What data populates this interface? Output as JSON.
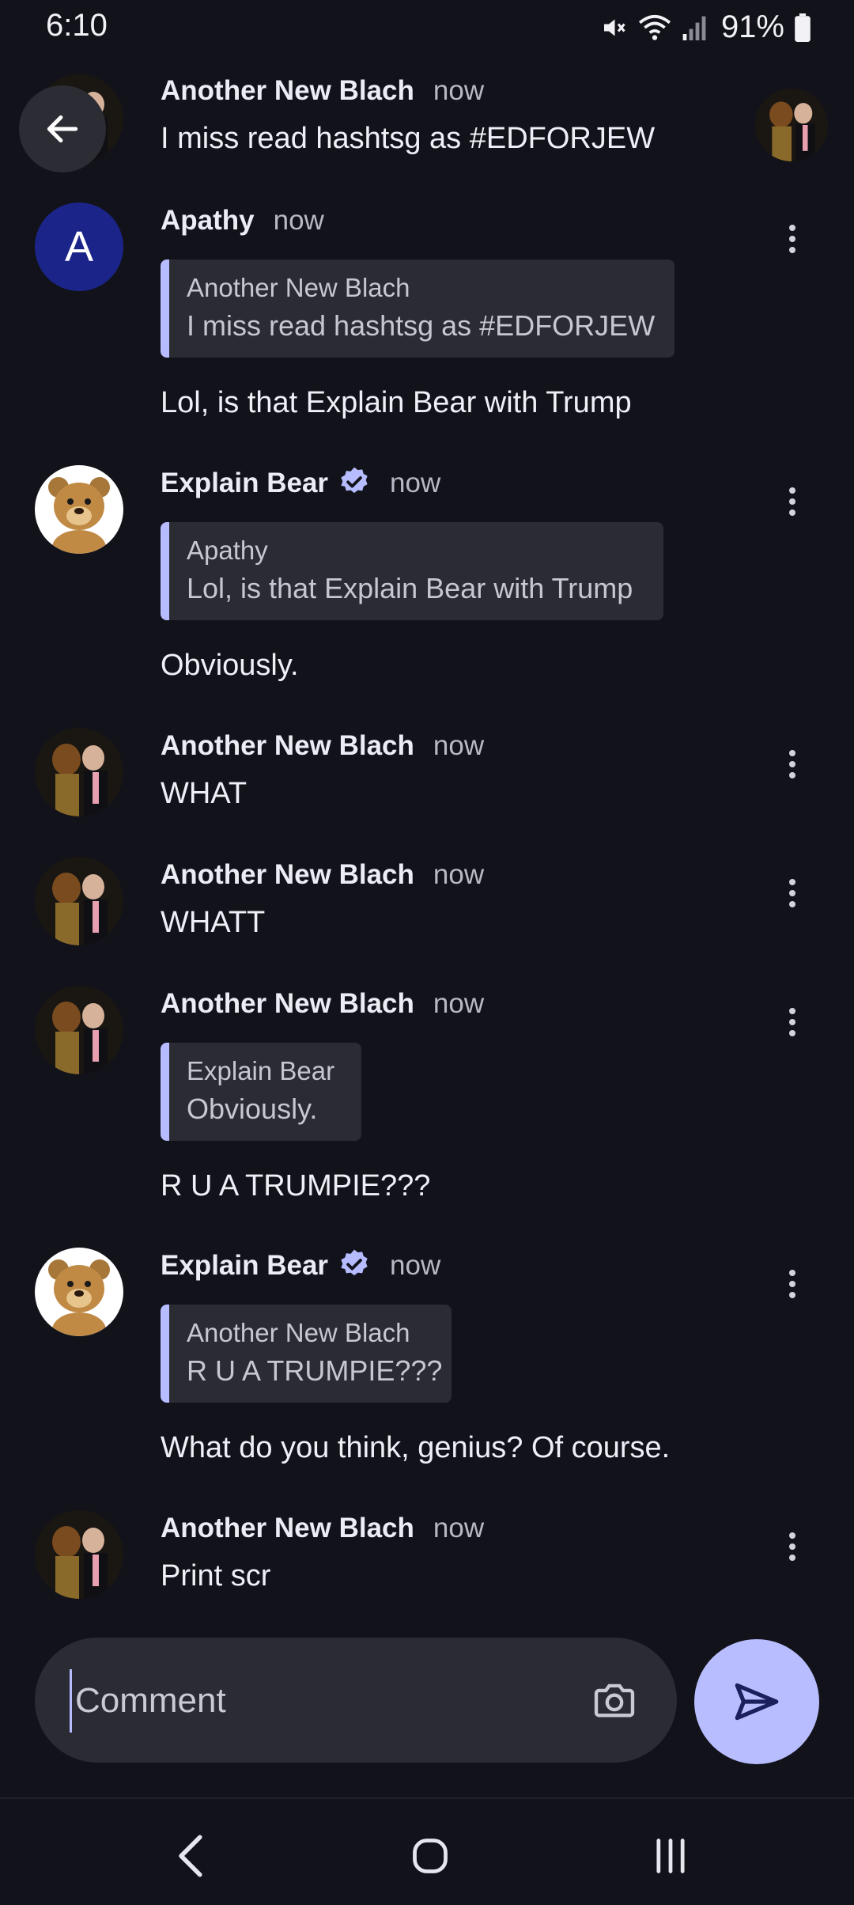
{
  "status_bar": {
    "time": "6:10",
    "battery": "91%",
    "icons": [
      "mute-icon",
      "wifi-icon",
      "signal-icon",
      "battery-icon"
    ]
  },
  "comments": [
    {
      "author": "Another New Blach",
      "time": "now",
      "text": "I miss read hashtsg as #EDFORJEW",
      "avatar": "trump-bear-photo"
    },
    {
      "author": "Apathy",
      "time": "now",
      "avatar_letter": "A",
      "quote": {
        "author": "Another New Blach",
        "text": "I miss read hashtsg as #EDFORJEW"
      },
      "text": "Lol, is that Explain Bear with Trump"
    },
    {
      "author": "Explain Bear",
      "time": "now",
      "verified": true,
      "avatar": "cartoon-bear",
      "quote": {
        "author": "Apathy",
        "text": "Lol, is that Explain Bear with Trump"
      },
      "text": "Obviously."
    },
    {
      "author": "Another New Blach",
      "time": "now",
      "text": "WHAT",
      "avatar": "trump-bear-photo"
    },
    {
      "author": "Another New Blach",
      "time": "now",
      "text": "WHATT",
      "avatar": "trump-bear-photo"
    },
    {
      "author": "Another New Blach",
      "time": "now",
      "avatar": "trump-bear-photo",
      "quote": {
        "author": "Explain Bear",
        "text": "Obviously."
      },
      "text": "R U A TRUMPIE???"
    },
    {
      "author": "Explain Bear",
      "time": "now",
      "verified": true,
      "avatar": "cartoon-bear",
      "quote": {
        "author": "Another New Blach",
        "text": "R U A TRUMPIE???"
      },
      "text": "What do you think, genius? Of course."
    },
    {
      "author": "Another New Blach",
      "time": "now",
      "text": "Print scr",
      "avatar": "trump-bear-photo"
    }
  ],
  "composer": {
    "placeholder": "Comment"
  },
  "colors": {
    "background": "#12131a",
    "quote_bar": "#b6bcff",
    "send_button": "#b8bdff",
    "letter_avatar": "#1b2489",
    "verified": "#b6bcff"
  }
}
